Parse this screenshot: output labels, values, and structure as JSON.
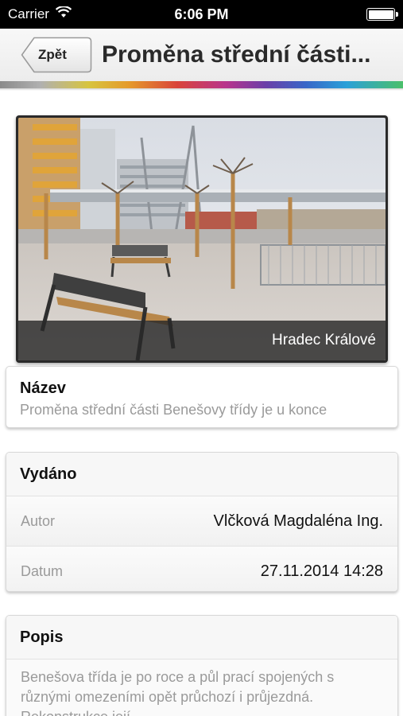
{
  "status_bar": {
    "carrier": "Carrier",
    "time": "6:06 PM",
    "icons": [
      "wifi-icon",
      "battery-icon"
    ]
  },
  "nav": {
    "back_label": "Zpět",
    "title": "Proměna střední části..."
  },
  "photo": {
    "caption": "Hradec Králové"
  },
  "name_section": {
    "title": "Název",
    "value": "Proměna střední části Benešovy třídy je u konce"
  },
  "published_section": {
    "title": "Vydáno",
    "author_label": "Autor",
    "author_value": "Vlčková Magdaléna Ing.",
    "date_label": "Datum",
    "date_value": "27.11.2014 14:28"
  },
  "description_section": {
    "title": "Popis",
    "text": "Benešova třída je po roce a půl prací spojených s různými omezeními opět průchozí i průjezdná. Rekonstrukce její"
  },
  "colors": {
    "status_bar_bg": "#000000",
    "nav_bg": "#f0f0f0",
    "label_gray": "#9a9a9a"
  }
}
